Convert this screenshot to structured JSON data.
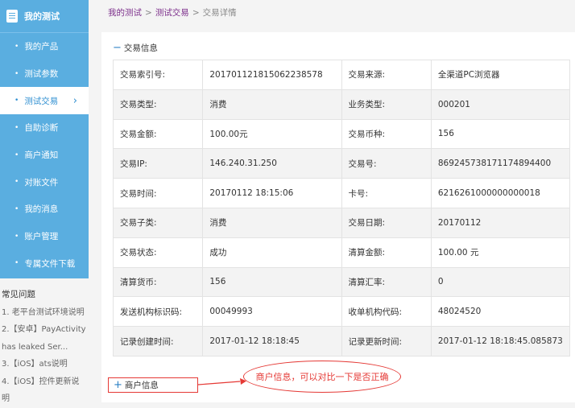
{
  "sidebar": {
    "title": "我的测试",
    "items": [
      {
        "label": "我的产品"
      },
      {
        "label": "测试参数"
      },
      {
        "label": "测试交易",
        "active": true
      },
      {
        "label": "自助诊断"
      },
      {
        "label": "商户通知"
      },
      {
        "label": "对账文件"
      },
      {
        "label": "我的消息"
      },
      {
        "label": "账户管理"
      },
      {
        "label": "专属文件下载"
      }
    ]
  },
  "faq": {
    "title": "常见问题",
    "links": [
      "1. 老平台测试环境说明",
      "2.【安卓】PayActivity",
      "has leaked Ser...",
      "3.【iOS】ats说明",
      "4.【iOS】控件更新说",
      "明"
    ]
  },
  "breadcrumb": {
    "items": [
      "我的测试",
      "测试交易",
      "交易详情"
    ],
    "separator": ">"
  },
  "sections": {
    "transaction_info": "交易信息",
    "merchant_info": "商户信息"
  },
  "symbols": {
    "collapse": "−",
    "expand": "+",
    "chevron": "›"
  },
  "table": {
    "rows": [
      [
        {
          "label": "交易索引号:",
          "value": "2017011218150622385 78"
        },
        {
          "label": "交易来源:",
          "value": "全渠道PC浏览器"
        }
      ],
      [
        {
          "label": "交易类型:",
          "value": "消费"
        },
        {
          "label": "业务类型:",
          "value": "000201"
        }
      ],
      [
        {
          "label": "交易金额:",
          "value": "100.00元"
        },
        {
          "label": "交易币种:",
          "value": "156"
        }
      ],
      [
        {
          "label": "交易IP:",
          "value": "146.240.31.250"
        },
        {
          "label": "交易号:",
          "value": "869245738171174894400"
        }
      ],
      [
        {
          "label": "交易时间:",
          "value": "20170112 18:15:06"
        },
        {
          "label": "卡号:",
          "value": "6216261000000000018"
        }
      ],
      [
        {
          "label": "交易子类:",
          "value": "消费"
        },
        {
          "label": "交易日期:",
          "value": "20170112"
        }
      ],
      [
        {
          "label": "交易状态:",
          "value": "成功"
        },
        {
          "label": "清算金额:",
          "value": "100.00 元"
        }
      ],
      [
        {
          "label": "清算货币:",
          "value": "156"
        },
        {
          "label": "清算汇率:",
          "value": "0"
        }
      ],
      [
        {
          "label": "发送机构标识码:",
          "value": "00049993"
        },
        {
          "label": "收单机构代码:",
          "value": "48024520"
        }
      ],
      [
        {
          "label": "记录创建时间:",
          "value": "2017-01-12 18:18:45"
        },
        {
          "label": "记录更新时间:",
          "value": "2017-01-12 18:18:45.085873"
        }
      ]
    ]
  },
  "annotation": {
    "text": "商户信息，可以对比一下是否正确",
    "color": "#e53935"
  }
}
